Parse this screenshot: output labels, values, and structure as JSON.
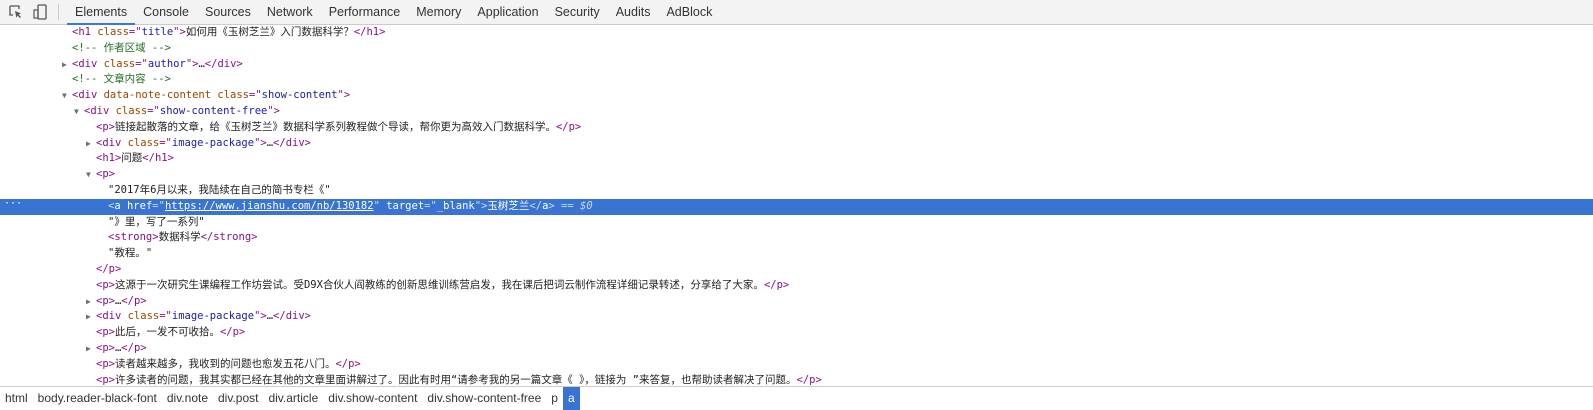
{
  "toolbar": {
    "icons": [
      "inspect-element-icon",
      "device-toolbar-icon"
    ],
    "tabs": [
      "Elements",
      "Console",
      "Sources",
      "Network",
      "Performance",
      "Memory",
      "Application",
      "Security",
      "Audits",
      "AdBlock"
    ],
    "active_tab": "Elements"
  },
  "colors": {
    "tag": "#881280",
    "attr_name": "#994500",
    "attr_value": "#1a1aa6",
    "comment": "#236e25",
    "selection": "#3a74d2"
  },
  "rows": [
    {
      "indent": 0,
      "arrow": "",
      "tokens": [
        [
          "tag",
          "<h1 "
        ],
        [
          "an",
          "class"
        ],
        [
          "tag",
          "=\""
        ],
        [
          "av",
          "title"
        ],
        [
          "tag",
          "\">"
        ],
        [
          "tx",
          "如何用《玉树芝兰》入门数据科学？"
        ],
        [
          "tag",
          "</h1>"
        ]
      ]
    },
    {
      "indent": 0,
      "arrow": "",
      "tokens": [
        [
          "cm",
          "<!-- 作者区域 -->"
        ]
      ]
    },
    {
      "indent": 0,
      "arrow": "right",
      "tokens": [
        [
          "tag",
          "<div "
        ],
        [
          "an",
          "class"
        ],
        [
          "tag",
          "=\""
        ],
        [
          "av",
          "author"
        ],
        [
          "tag",
          "\">"
        ],
        [
          "tx",
          "…"
        ],
        [
          "tag",
          "</div>"
        ]
      ]
    },
    {
      "indent": 0,
      "arrow": "",
      "tokens": [
        [
          "cm",
          "<!-- 文章内容 -->"
        ]
      ]
    },
    {
      "indent": 0,
      "arrow": "down",
      "tokens": [
        [
          "tag",
          "<div "
        ],
        [
          "an",
          "data-note-content class"
        ],
        [
          "tag",
          "=\""
        ],
        [
          "av",
          "show-content"
        ],
        [
          "tag",
          "\">"
        ]
      ]
    },
    {
      "indent": 1,
      "arrow": "down",
      "tokens": [
        [
          "tag",
          "<div "
        ],
        [
          "an",
          "class"
        ],
        [
          "tag",
          "=\""
        ],
        [
          "av",
          "show-content-free"
        ],
        [
          "tag",
          "\">"
        ]
      ]
    },
    {
      "indent": 2,
      "arrow": "",
      "tokens": [
        [
          "tag",
          "<p>"
        ],
        [
          "tx",
          "链接起散落的文章，给《玉树芝兰》数据科学系列教程做个导读，帮你更为高效入门数据科学。"
        ],
        [
          "tag",
          "</p>"
        ]
      ]
    },
    {
      "indent": 2,
      "arrow": "right",
      "tokens": [
        [
          "tag",
          "<div "
        ],
        [
          "an",
          "class"
        ],
        [
          "tag",
          "=\""
        ],
        [
          "av",
          "image-package"
        ],
        [
          "tag",
          "\">"
        ],
        [
          "tx",
          "…"
        ],
        [
          "tag",
          "</div>"
        ]
      ]
    },
    {
      "indent": 2,
      "arrow": "",
      "tokens": [
        [
          "tag",
          "<h1>"
        ],
        [
          "tx",
          "问题"
        ],
        [
          "tag",
          "</h1>"
        ]
      ]
    },
    {
      "indent": 2,
      "arrow": "down",
      "tokens": [
        [
          "tag",
          "<p>"
        ]
      ]
    },
    {
      "indent": 3,
      "arrow": "",
      "tokens": [
        [
          "tx",
          "\"2017年6月以来，我陆续在自己的简书专栏《\""
        ]
      ]
    },
    {
      "indent": 3,
      "arrow": "",
      "selected": true,
      "tokens": [
        [
          "br",
          "<"
        ],
        [
          "tag",
          "a "
        ],
        [
          "an",
          "href"
        ],
        [
          "br",
          "=\""
        ],
        [
          "av link",
          "https://www.jianshu.com/nb/130182"
        ],
        [
          "br",
          "\" "
        ],
        [
          "an",
          "target"
        ],
        [
          "br",
          "=\""
        ],
        [
          "av",
          "_blank"
        ],
        [
          "br",
          "\">"
        ],
        [
          "tx",
          "玉树芝兰"
        ],
        [
          "br",
          "</"
        ],
        [
          "tag",
          "a"
        ],
        [
          "br",
          ">"
        ],
        [
          "eq",
          " == $0"
        ]
      ]
    },
    {
      "indent": 3,
      "arrow": "",
      "tokens": [
        [
          "tx",
          "\"》里，写了一系列\""
        ]
      ]
    },
    {
      "indent": 3,
      "arrow": "",
      "tokens": [
        [
          "tag",
          "<strong>"
        ],
        [
          "tx",
          "数据科学"
        ],
        [
          "tag",
          "</strong>"
        ]
      ]
    },
    {
      "indent": 3,
      "arrow": "",
      "tokens": [
        [
          "tx",
          "\"教程。\""
        ]
      ]
    },
    {
      "indent": 2,
      "arrow": "",
      "tokens": [
        [
          "tag",
          "</p>"
        ]
      ]
    },
    {
      "indent": 2,
      "arrow": "",
      "tokens": [
        [
          "tag",
          "<p>"
        ],
        [
          "tx",
          "这源于一次研究生课编程工作坊尝试。受D9X合伙人阎教练的创新思维训练营启发，我在课后把词云制作流程详细记录转述，分享给了大家。"
        ],
        [
          "tag",
          "</p>"
        ]
      ]
    },
    {
      "indent": 2,
      "arrow": "right",
      "tokens": [
        [
          "tag",
          "<p>"
        ],
        [
          "tx",
          "…"
        ],
        [
          "tag",
          "</p>"
        ]
      ]
    },
    {
      "indent": 2,
      "arrow": "right",
      "tokens": [
        [
          "tag",
          "<div "
        ],
        [
          "an",
          "class"
        ],
        [
          "tag",
          "=\""
        ],
        [
          "av",
          "image-package"
        ],
        [
          "tag",
          "\">"
        ],
        [
          "tx",
          "…"
        ],
        [
          "tag",
          "</div>"
        ]
      ]
    },
    {
      "indent": 2,
      "arrow": "",
      "tokens": [
        [
          "tag",
          "<p>"
        ],
        [
          "tx",
          "此后，一发不可收拾。"
        ],
        [
          "tag",
          "</p>"
        ]
      ]
    },
    {
      "indent": 2,
      "arrow": "right",
      "tokens": [
        [
          "tag",
          "<p>"
        ],
        [
          "tx",
          "…"
        ],
        [
          "tag",
          "</p>"
        ]
      ]
    },
    {
      "indent": 2,
      "arrow": "",
      "tokens": [
        [
          "tag",
          "<p>"
        ],
        [
          "tx",
          "读者越来越多，我收到的问题也愈发五花八门。"
        ],
        [
          "tag",
          "</p>"
        ]
      ]
    },
    {
      "indent": 2,
      "arrow": "",
      "tokens": [
        [
          "tag",
          "<p>"
        ],
        [
          "tx",
          "许多读者的问题，我其实都已经在其他的文章里面讲解过了。因此有时用“请参考我的另一篇文章《 》，链接为 ”来答复，也帮助读者解决了问题。"
        ],
        [
          "tag",
          "</p>"
        ]
      ]
    }
  ],
  "selected_row_dots": "···",
  "breadcrumbs": [
    "html",
    "body.reader-black-font",
    "div.note",
    "div.post",
    "div.article",
    "div.show-content",
    "div.show-content-free",
    "p",
    "a"
  ],
  "active_breadcrumb": "a"
}
